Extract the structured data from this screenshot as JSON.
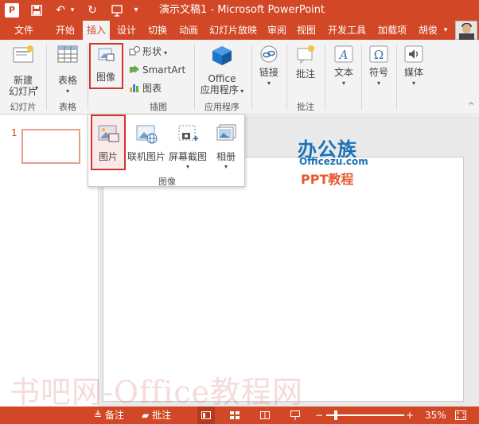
{
  "titlebar": {
    "app_letter": "P",
    "title": "演示文稿1 - Microsoft PowerPoint"
  },
  "tabs": [
    "文件",
    "开始",
    "插入",
    "设计",
    "切换",
    "动画",
    "幻灯片放映",
    "审阅",
    "视图",
    "开发工具",
    "加载项",
    "胡俊"
  ],
  "active_tab": "插入",
  "ribbon": {
    "new_slide": "新建\n幻灯片",
    "new_slide_line1": "新建",
    "new_slide_line2": "幻灯片",
    "table": "表格",
    "images": "图像",
    "shapes": "形状",
    "smartart": "SmartArt",
    "chart": "图表",
    "office_line1": "Office",
    "office_line2": "应用程序",
    "link": "链接",
    "comment": "批注",
    "text": "文本",
    "symbol": "符号",
    "media": "媒体",
    "groups": {
      "slides": "幻灯片",
      "tables": "表格",
      "illustrations": "插图",
      "apps": "应用程序",
      "comments": "批注"
    }
  },
  "dropdown": {
    "items": [
      "图片",
      "联机图片",
      "屏幕截图",
      "相册"
    ],
    "label": "图像"
  },
  "slide_panel": {
    "slide_number": "1"
  },
  "logo": {
    "top": "办公族",
    "mid": "Officezu.com",
    "bot": "PPT教程"
  },
  "watermark": "书吧网-Office教程网",
  "statusbar": {
    "notes": "备注",
    "comments": "批注",
    "zoom": "35%"
  },
  "colors": {
    "accent": "#d24726",
    "highlight": "#d0352f",
    "logo_blue": "#1a72b8",
    "logo_orange": "#e8572e"
  }
}
